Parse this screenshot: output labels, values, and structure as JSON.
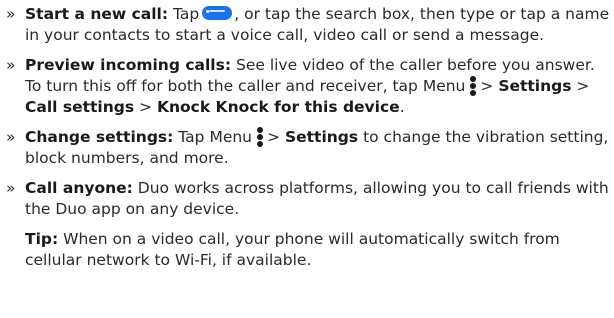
{
  "bullet": "»",
  "items": [
    {
      "title": "Start a new call:",
      "t1": "Tap",
      "t2": ", or tap the search box, then type or tap a name in your contacts to start a voice call, video call or send a message."
    },
    {
      "title": "Preview incoming calls:",
      "t1": "See live video of the caller before you answer. To turn this off for both the caller and receiver, tap Menu",
      "sep1": ">",
      "b1": "Settings",
      "sep2": ">",
      "b2": "Call settings",
      "sep3": ">",
      "b3": "Knock Knock for this device",
      "end": "."
    },
    {
      "title": "Change settings:",
      "t1": "Tap Menu",
      "sep1": ">",
      "b1": "Settings",
      "t2": "to change the vibration setting, block numbers, and more."
    },
    {
      "title": "Call anyone:",
      "t1": "Duo works across platforms, allowing you to call friends with the Duo app on any device."
    }
  ],
  "tip": {
    "title": "Tip:",
    "text": "When on a video call, your phone will automatically switch from cellular network to Wi-Fi, if available."
  },
  "icons": {
    "start_chat": "start-chat-pill-icon",
    "menu": "vertical-dots-menu-icon"
  },
  "colors": {
    "accent": "#1a73e8",
    "text": "#2a2a2a"
  }
}
